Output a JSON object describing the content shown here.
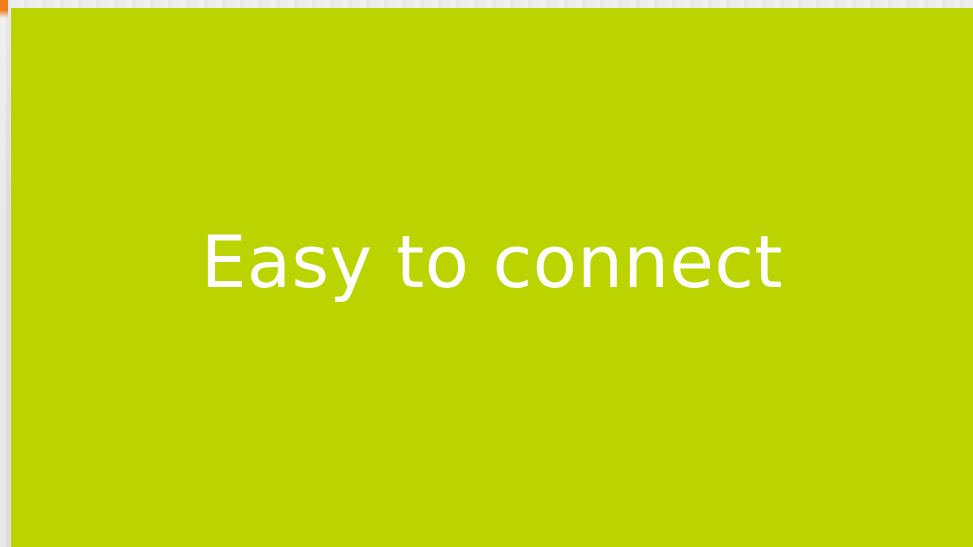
{
  "colors": {
    "panel_background": "#bbd400",
    "text": "#ffffff",
    "accent": "#f07c1a"
  },
  "panel": {
    "heading": "Easy to connect"
  }
}
